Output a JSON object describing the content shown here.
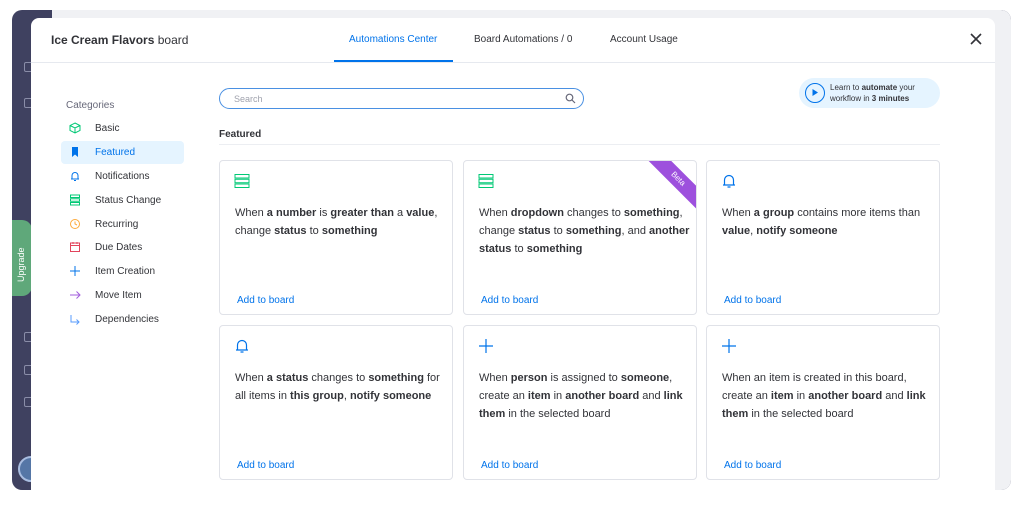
{
  "header": {
    "board_name": "Ice Cream Flavors",
    "board_suffix": "board",
    "tabs": [
      {
        "label": "Automations Center"
      },
      {
        "label": "Board Automations / 0"
      },
      {
        "label": "Account Usage"
      }
    ]
  },
  "background": {
    "upgrade_label": "Upgrade"
  },
  "sidebar": {
    "title": "Categories",
    "items": [
      {
        "label": "Basic",
        "icon": "cube-icon"
      },
      {
        "label": "Featured",
        "icon": "bookmark-icon"
      },
      {
        "label": "Notifications",
        "icon": "bell-icon"
      },
      {
        "label": "Status Change",
        "icon": "status-icon"
      },
      {
        "label": "Recurring",
        "icon": "clock-icon"
      },
      {
        "label": "Due Dates",
        "icon": "calendar-icon"
      },
      {
        "label": "Item Creation",
        "icon": "plus-icon"
      },
      {
        "label": "Move Item",
        "icon": "arrow-right-icon"
      },
      {
        "label": "Dependencies",
        "icon": "dependency-icon"
      }
    ]
  },
  "search": {
    "placeholder": "Search"
  },
  "learn": {
    "prefix": "Learn to ",
    "bold1": "automate",
    "mid": " your workflow in ",
    "bold2": "3 minutes"
  },
  "section": {
    "title": "Featured"
  },
  "cards": [
    {
      "icon": "status-icon",
      "segments": [
        [
          "When ",
          false
        ],
        [
          "a number",
          true
        ],
        [
          " is ",
          false
        ],
        [
          "greater than",
          true
        ],
        [
          " a ",
          false
        ],
        [
          "value",
          true
        ],
        [
          ", change ",
          false
        ],
        [
          "status",
          true
        ],
        [
          " to ",
          false
        ],
        [
          "something",
          true
        ]
      ],
      "add_label": "Add to board"
    },
    {
      "icon": "status-icon",
      "badge": "Beta",
      "segments": [
        [
          "When ",
          false
        ],
        [
          "dropdown",
          true
        ],
        [
          " changes to ",
          false
        ],
        [
          "something",
          true
        ],
        [
          ", change ",
          false
        ],
        [
          "status",
          true
        ],
        [
          " to ",
          false
        ],
        [
          "something",
          true
        ],
        [
          ", and ",
          false
        ],
        [
          "another status",
          true
        ],
        [
          " to ",
          false
        ],
        [
          "something",
          true
        ]
      ],
      "add_label": "Add to board"
    },
    {
      "icon": "bell-icon",
      "segments": [
        [
          "When ",
          false
        ],
        [
          "a group",
          true
        ],
        [
          " contains more items than ",
          false
        ],
        [
          "value",
          true
        ],
        [
          ", ",
          false
        ],
        [
          "notify someone",
          true
        ]
      ],
      "add_label": "Add to board"
    },
    {
      "icon": "bell-icon",
      "segments": [
        [
          "When ",
          false
        ],
        [
          "a status",
          true
        ],
        [
          " changes to ",
          false
        ],
        [
          "something",
          true
        ],
        [
          " for all items in ",
          false
        ],
        [
          "this group",
          true
        ],
        [
          ", ",
          false
        ],
        [
          "notify",
          true
        ],
        [
          " ",
          false
        ],
        [
          "someone",
          true
        ]
      ],
      "add_label": "Add to board"
    },
    {
      "icon": "plus-icon",
      "segments": [
        [
          "When ",
          false
        ],
        [
          "person",
          true
        ],
        [
          " is assigned to ",
          false
        ],
        [
          "someone",
          true
        ],
        [
          ", create an ",
          false
        ],
        [
          "item",
          true
        ],
        [
          " in ",
          false
        ],
        [
          "another board",
          true
        ],
        [
          " and ",
          false
        ],
        [
          "link them",
          true
        ],
        [
          " in the selected board",
          false
        ]
      ],
      "add_label": "Add to board"
    },
    {
      "icon": "plus-icon",
      "segments": [
        [
          "When an item is created in this board, create an ",
          false
        ],
        [
          "item",
          true
        ],
        [
          " in ",
          false
        ],
        [
          "another board",
          true
        ],
        [
          " and ",
          false
        ],
        [
          "link them",
          true
        ],
        [
          " in the selected board",
          false
        ]
      ],
      "add_label": "Add to board"
    }
  ],
  "colors": {
    "accent": "#0073ea",
    "beta": "#9d50dd",
    "status_icon": "#00c875"
  }
}
